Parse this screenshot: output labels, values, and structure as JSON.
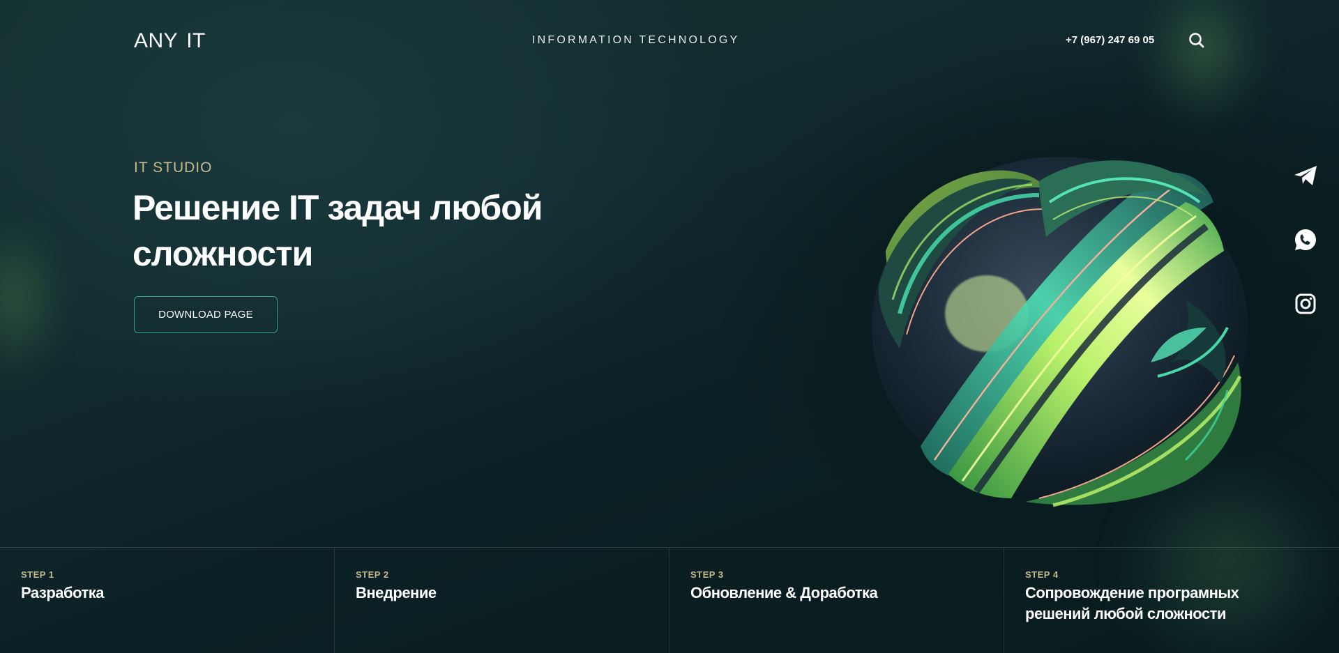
{
  "header": {
    "logo_left": "ANY",
    "logo_right": "IT",
    "tagline": "INFORMATION TECHNOLOGY",
    "phone": "+7 (967) 247 69 05"
  },
  "hero": {
    "eyebrow": "IT STUDIO",
    "title": "Решение IT задач любой сложности",
    "button_label": "DOWNLOAD PAGE"
  },
  "social": [
    {
      "icon": "telegram-icon"
    },
    {
      "icon": "whatsapp-icon"
    },
    {
      "icon": "instagram-icon"
    }
  ],
  "steps": [
    {
      "number": "STEP 1",
      "title": "Разработка"
    },
    {
      "number": "STEP 2",
      "title": "Внедрение"
    },
    {
      "number": "STEP 3",
      "title": "Обновление & Доработка"
    },
    {
      "number": "STEP 4",
      "title": "Сопровождение програмных решений любой сложности"
    }
  ],
  "colors": {
    "background": "#112a2e",
    "accent_gold": "#c6b98b",
    "button_border": "#2fa38a",
    "text": "#ffffff"
  }
}
